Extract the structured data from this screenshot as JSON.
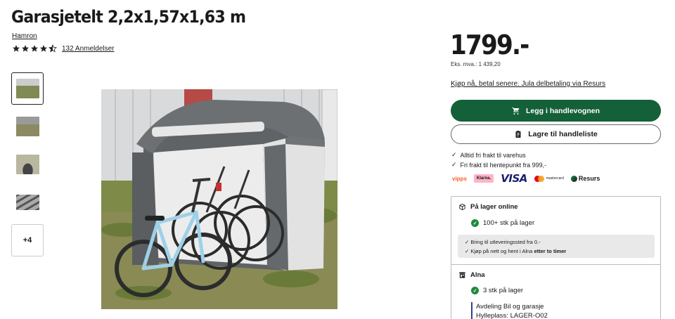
{
  "product": {
    "title": "Garasjetelt 2,2x1,57x1,63 m",
    "brand": "Hamron",
    "rating": 4.5,
    "reviews_label": "132 Anmeldelser"
  },
  "gallery": {
    "more_label": "+4"
  },
  "pricing": {
    "price": "1799.-",
    "vat_note": "Eks. mva.: 1 439,20",
    "finance_link": "Kjøp nå, betal senere. Jula delbetaling via Resurs"
  },
  "actions": {
    "add_to_cart": "Legg i handlevognen",
    "save_to_list": "Lagre til handleliste"
  },
  "usps": [
    "Alltid fri frakt til varehus",
    "Fri frakt til hentepunkt fra 999,-"
  ],
  "payments": {
    "vipps": "vipps",
    "klarna": "Klarna.",
    "visa": "VISA",
    "mastercard": "mastercard",
    "resurs": "Resurs"
  },
  "stock": {
    "online_title": "På lager online",
    "online_qty": "100+ stk på lager",
    "info_line1": "Bring til utleveringssted fra 0.-",
    "info_line2_prefix": "Kjøp på nett og hent i Alna ",
    "info_line2_bold": "etter to timer",
    "store_title": "Alna",
    "store_qty": "3 stk på lager",
    "department": "Avdeling Bil og garasje",
    "shelf": "Hylleplass: LAGER-O02"
  },
  "colors": {
    "primary_green": "#146038",
    "check_green": "#1e8a3c"
  }
}
